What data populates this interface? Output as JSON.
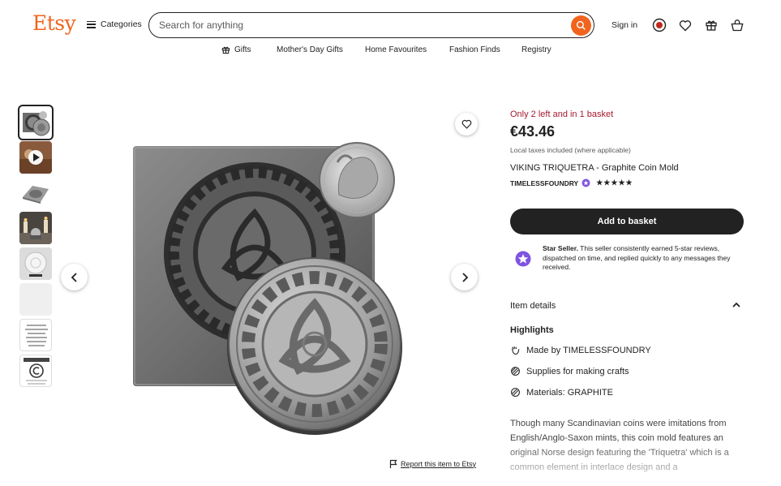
{
  "header": {
    "logo": "Etsy",
    "categories_label": "Categories",
    "search_placeholder": "Search for anything",
    "signin_label": "Sign in"
  },
  "nav": {
    "items": [
      {
        "label": "Gifts",
        "icon": "gift-icon"
      },
      {
        "label": "Mother's Day Gifts"
      },
      {
        "label": "Home Favourites"
      },
      {
        "label": "Fashion Finds"
      },
      {
        "label": "Registry"
      }
    ]
  },
  "gallery": {
    "thumbnails": [
      {
        "kind": "coin-mold",
        "active": true
      },
      {
        "kind": "video",
        "icon": "play-icon"
      },
      {
        "kind": "mold-flat"
      },
      {
        "kind": "candles"
      },
      {
        "kind": "coin-white"
      },
      {
        "kind": "blank"
      },
      {
        "kind": "text-note",
        "text": "PLEASE READ ITEM DESCRIPTION FOR A BRIEF SUMMARY OF MATERIALS & DIMENSIONS"
      },
      {
        "kind": "copyright",
        "text": "COPYRIGHT NOTICE"
      }
    ],
    "report_label": "Report this item to Etsy"
  },
  "product": {
    "stock_note": "Only 2 left and in 1 basket",
    "price": "€43.46",
    "tax_note": "Local taxes included (where applicable)",
    "title": "VIKING TRIQUETRA - Graphite Coin Mold",
    "shop_name": "TIMELESSFOUNDRY",
    "rating_stars": 5,
    "add_to_basket_label": "Add to basket",
    "star_seller_title": "Star Seller.",
    "star_seller_text": "This seller consistently earned 5-star reviews, dispatched on time, and replied quickly to any messages they received."
  },
  "details": {
    "section_label": "Item details",
    "highlights_label": "Highlights",
    "highlights": [
      {
        "prefix": "Made by ",
        "value": "TIMELESSFOUNDRY",
        "icon": "hand-wave-icon"
      },
      {
        "prefix": "Supplies for making crafts",
        "value": "",
        "icon": "craft-supplies-icon"
      },
      {
        "prefix": "Materials: ",
        "value": "GRAPHITE",
        "icon": "materials-icon"
      }
    ],
    "description": "Though many Scandinavian coins were imitations from English/Anglo-Saxon mints, this coin mold features an original Norse design featuring the 'Triquetra' which is a common element in interlace design and a"
  },
  "colors": {
    "brand_orange": "#f1641e",
    "stock_red": "#a61a2e",
    "star_seller_purple": "#7f54e0",
    "text_dark": "#222222"
  }
}
